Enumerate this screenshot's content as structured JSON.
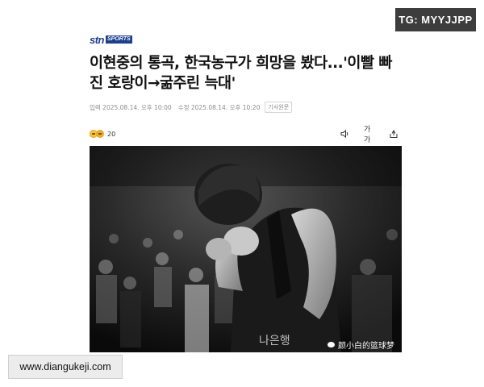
{
  "overlay": {
    "tg_badge": "TG: MYYJJPP",
    "site_badge": "www.diangukeji.com"
  },
  "article": {
    "logo_main": "stn",
    "logo_sub": "SPORTS",
    "headline": "이현중의 통곡, 한국농구가 희망을 봤다...'이빨 빠진 호랑이→굶주린 늑대'",
    "meta_input": "입력 2025.08.14. 오후 10:00",
    "meta_modified": "수정 2025.08.14. 오후 10:20",
    "meta_original": "기사원문",
    "reaction_count": "20",
    "tools": {
      "audio": "speaker-icon",
      "font_size_label": "가가",
      "share": "share-icon"
    }
  },
  "photo": {
    "jersey_text": "나은행",
    "watermark": "颜小白的篮球梦"
  },
  "colors": {
    "logo": "#1d3f8c",
    "badge_dark": "#3d3d3d",
    "meta_gray": "#8b8b8b"
  }
}
